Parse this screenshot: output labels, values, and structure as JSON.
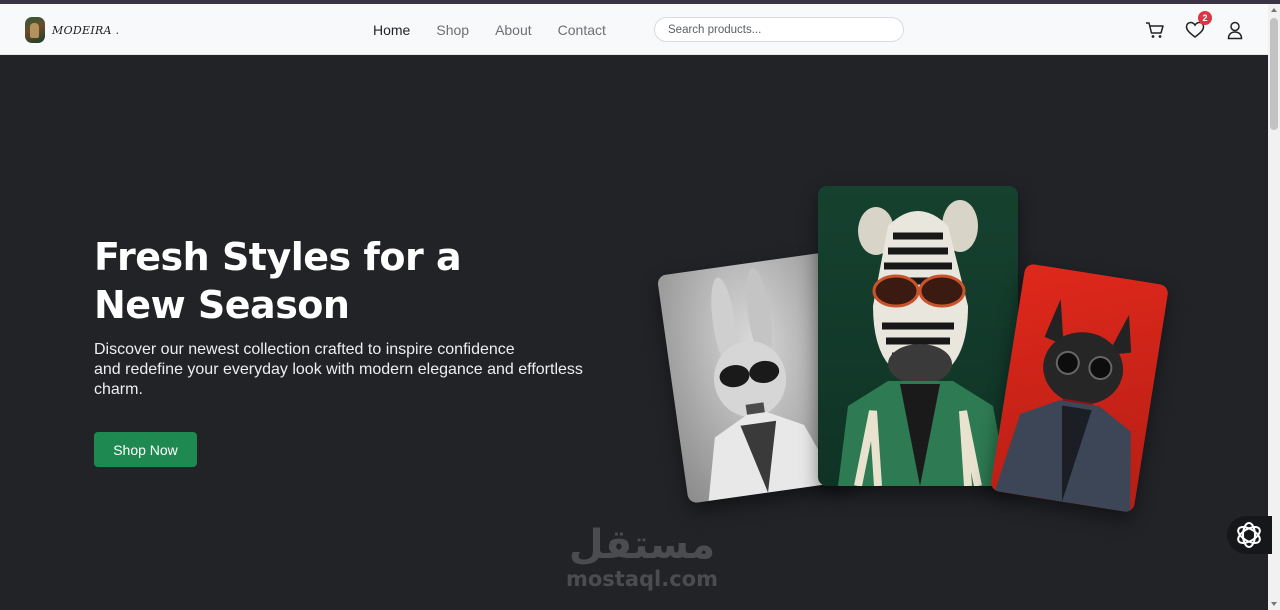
{
  "brand": {
    "name": "MODEIRA ."
  },
  "nav": {
    "links": [
      {
        "label": "Home",
        "active": true
      },
      {
        "label": "Shop",
        "active": false
      },
      {
        "label": "About",
        "active": false
      },
      {
        "label": "Contact",
        "active": false
      }
    ]
  },
  "search": {
    "placeholder": "Search products..."
  },
  "icons": {
    "cart": "cart-icon",
    "wishlist": "heart-icon",
    "account": "user-icon"
  },
  "wishlist_count": "2",
  "hero": {
    "title_line1": "Fresh Styles for a",
    "title_line2": "New Season",
    "subtitle_line1": "Discover our newest collection crafted to inspire confidence",
    "subtitle_line2": "and redefine your everyday look with modern elegance and effortless",
    "subtitle_line3": "charm.",
    "cta_label": "Shop Now"
  },
  "watermark": {
    "arabic": "مستقل",
    "latin": "mostaql.com"
  },
  "colors": {
    "background": "#212327",
    "navbar": "#f8f9fb",
    "cta": "#1e8a52",
    "badge": "#dc3545"
  }
}
